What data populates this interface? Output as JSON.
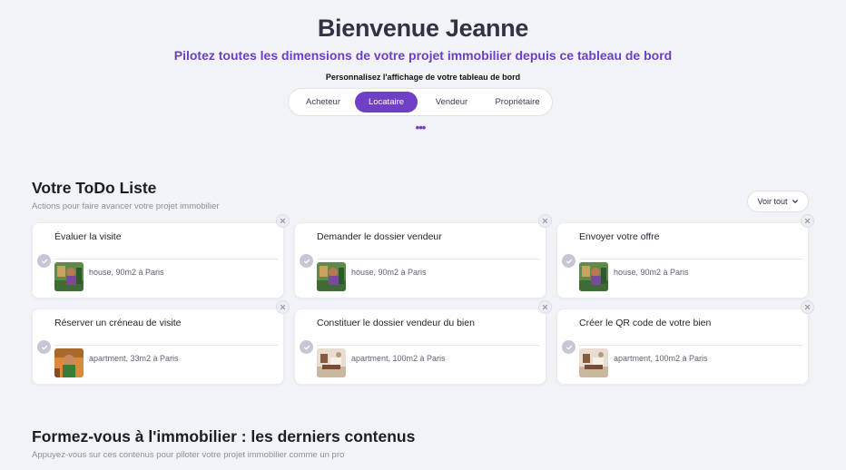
{
  "header": {
    "title": "Bienvenue Jeanne",
    "subtitle": "Pilotez toutes les dimensions de votre projet immobilier depuis ce tableau de bord",
    "customize_label": "Personnalisez l'affichage de votre tableau de bord",
    "tabs": [
      {
        "label": "Acheteur",
        "active": false
      },
      {
        "label": "Locataire",
        "active": true
      },
      {
        "label": "Vendeur",
        "active": false
      },
      {
        "label": "Propriétaire",
        "active": false
      }
    ],
    "more_icon": "more-dots-icon"
  },
  "todo": {
    "title": "Votre ToDo Liste",
    "subtitle": "Actions pour faire avancer votre projet immobilier",
    "see_all_label": "Voir tout",
    "cards": [
      {
        "title": "Évaluer la visite",
        "meta": "house, 90m2 à Paris",
        "thumb": "green"
      },
      {
        "title": "Demander le dossier vendeur",
        "meta": "house, 90m2 à Paris",
        "thumb": "green"
      },
      {
        "title": "Envoyer votre offre",
        "meta": "house, 90m2 à Paris",
        "thumb": "green"
      },
      {
        "title": "Réserver un créneau de visite",
        "meta": "apartment, 33m2 à Paris",
        "thumb": "orange"
      },
      {
        "title": "Constituer le dossier vendeur du bien",
        "meta": "apartment, 100m2 à Paris",
        "thumb": "beige"
      },
      {
        "title": "Créer le QR code de votre bien",
        "meta": "apartment, 100m2 à Paris",
        "thumb": "beige"
      }
    ]
  },
  "learn": {
    "title": "Formez-vous à l'immobilier : les derniers contenus",
    "subtitle": "Appuyez-vous sur ces contenus pour piloter votre projet immobilier comme un pro"
  },
  "colors": {
    "accent": "#6f3fc6",
    "subtitle": "#6c3fc8",
    "background": "#f2f3f7"
  }
}
